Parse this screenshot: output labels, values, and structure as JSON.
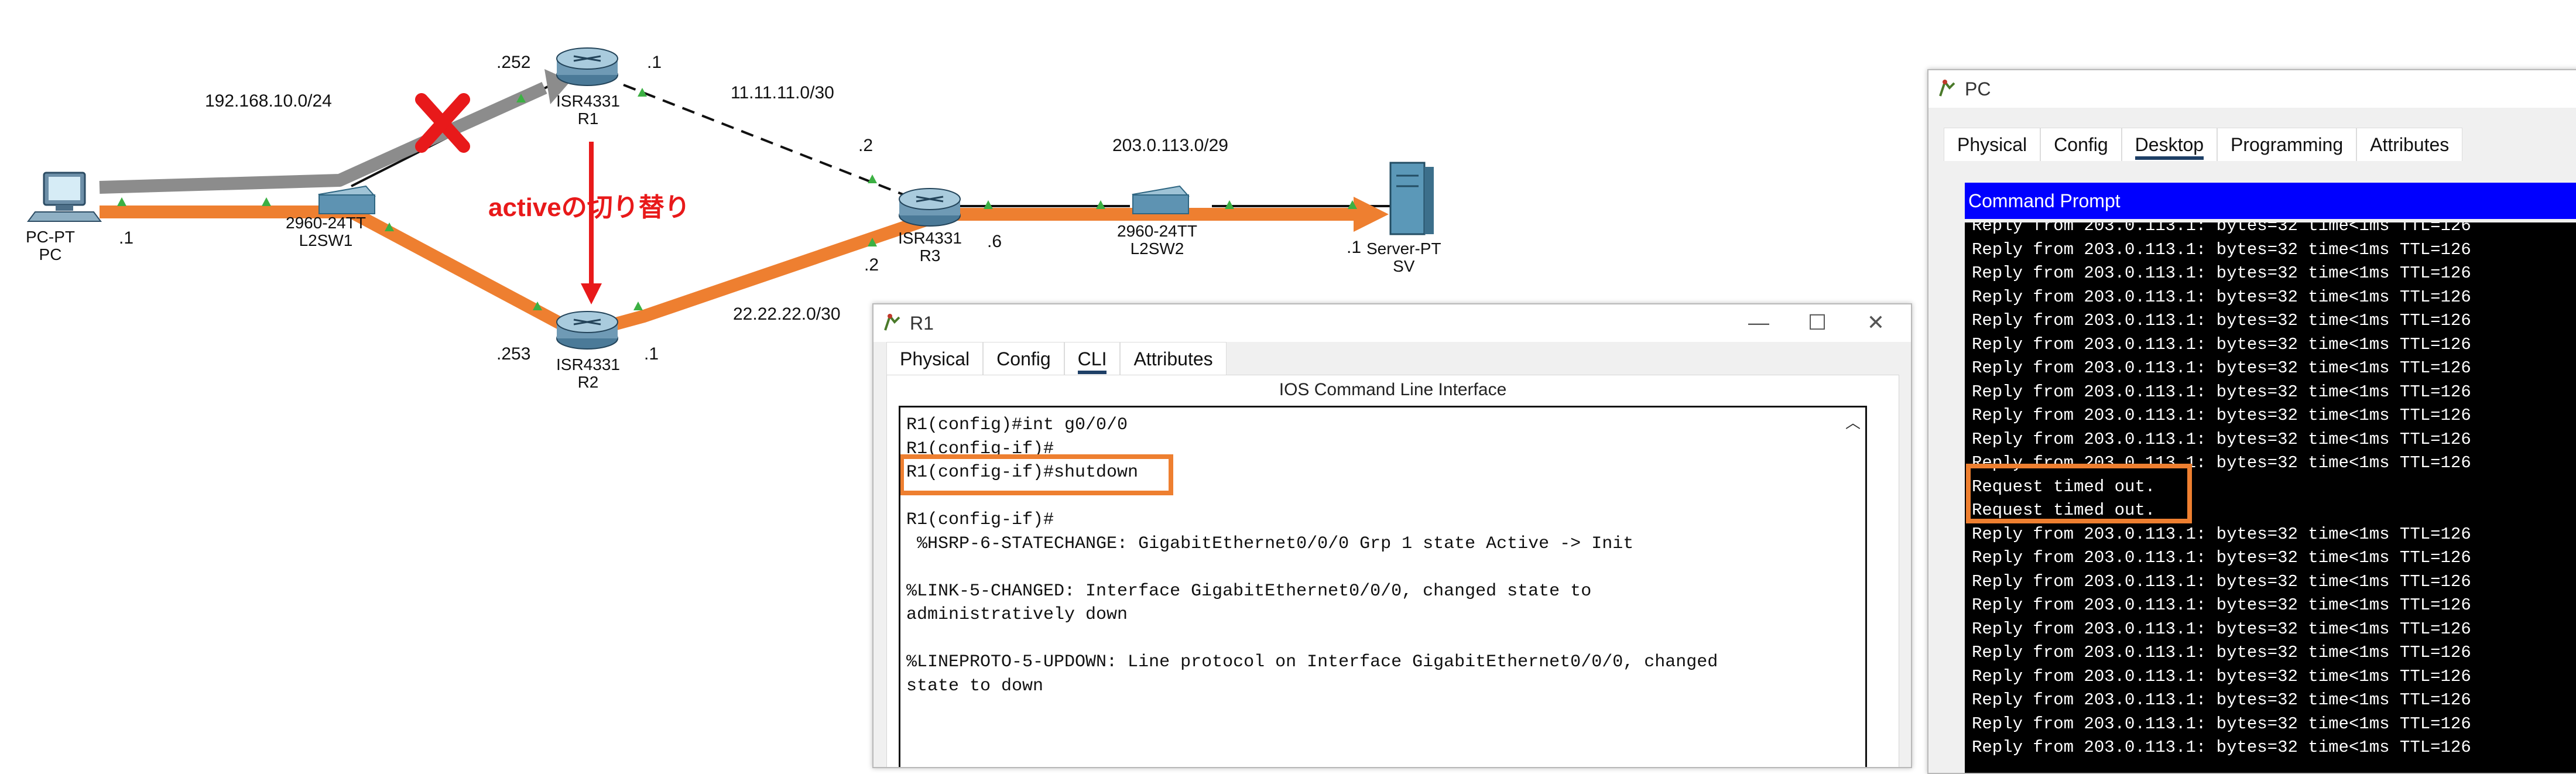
{
  "topology": {
    "subnets": {
      "lan": "192.168.10.0/24",
      "r1_r3": "11.11.11.0/30",
      "r2_r3": "22.22.22.0/30",
      "wan": "203.0.113.0/29"
    },
    "iface_labels": {
      "pc": ".1",
      "r1_left": ".252",
      "r1_right": ".1",
      "r2_left": ".253",
      "r2_right": ".1",
      "r3_top": ".2",
      "r3_bottom": ".2",
      "r3_right": ".6",
      "sv": ".1"
    },
    "devices": {
      "pc": {
        "model": "PC-PT",
        "name": "PC"
      },
      "l2sw1": {
        "model": "2960-24TT",
        "name": "L2SW1"
      },
      "r1": {
        "model": "ISR4331",
        "name": "R1"
      },
      "r2": {
        "model": "ISR4331",
        "name": "R2"
      },
      "r3": {
        "model": "ISR4331",
        "name": "R3"
      },
      "l2sw2": {
        "model": "2960-24TT",
        "name": "L2SW2"
      },
      "sv": {
        "model": "Server-PT",
        "name": "SV"
      }
    },
    "failover_label": "activeの切り替り",
    "colors": {
      "path": "#ee7f30",
      "failed_path": "#8c8c8c",
      "failure": "#e8191a",
      "link_up": "#3cb043"
    }
  },
  "r1_window": {
    "title": "R1",
    "tabs": [
      "Physical",
      "Config",
      "CLI",
      "Attributes"
    ],
    "active_tab": "CLI",
    "caption": "IOS Command Line Interface",
    "cli_lines": [
      "R1(config)#int g0/0/0",
      "R1(config-if)#",
      "R1(config-if)#shutdown",
      "",
      "R1(config-if)#",
      " %HSRP-6-STATECHANGE: GigabitEthernet0/0/0 Grp 1 state Active -> Init",
      "",
      "%LINK-5-CHANGED: Interface GigabitEthernet0/0/0, changed state to",
      "administratively down",
      "",
      "%LINEPROTO-5-UPDOWN: Line protocol on Interface GigabitEthernet0/0/0, changed",
      "state to down"
    ]
  },
  "pc_window": {
    "title": "PC",
    "tabs": [
      "Physical",
      "Config",
      "Desktop",
      "Programming",
      "Attributes"
    ],
    "active_tab": "Desktop",
    "cmd_title": "Command Prompt",
    "cmd_lines": [
      "Reply from 203.0.113.1: bytes=32 time<1ms TTL=126",
      "Reply from 203.0.113.1: bytes=32 time<1ms TTL=126",
      "Reply from 203.0.113.1: bytes=32 time<1ms TTL=126",
      "Reply from 203.0.113.1: bytes=32 time<1ms TTL=126",
      "Reply from 203.0.113.1: bytes=32 time<1ms TTL=126",
      "Reply from 203.0.113.1: bytes=32 time<1ms TTL=126",
      "Reply from 203.0.113.1: bytes=32 time<1ms TTL=126",
      "Reply from 203.0.113.1: bytes=32 time<1ms TTL=126",
      "Reply from 203.0.113.1: bytes=32 time<1ms TTL=126",
      "Reply from 203.0.113.1: bytes=32 time<1ms TTL=126",
      "Reply from 203.0.113.1: bytes=32 time<1ms TTL=126",
      "Request timed out.",
      "Request timed out.",
      "Reply from 203.0.113.1: bytes=32 time<1ms TTL=126",
      "Reply from 203.0.113.1: bytes=32 time<1ms TTL=126",
      "Reply from 203.0.113.1: bytes=32 time<1ms TTL=126",
      "Reply from 203.0.113.1: bytes=32 time<1ms TTL=126",
      "Reply from 203.0.113.1: bytes=32 time<1ms TTL=126",
      "Reply from 203.0.113.1: bytes=32 time<1ms TTL=126",
      "Reply from 203.0.113.1: bytes=32 time<1ms TTL=126",
      "Reply from 203.0.113.1: bytes=32 time<1ms TTL=126",
      "Reply from 203.0.113.1: bytes=32 time<1ms TTL=126",
      "Reply from 203.0.113.1: bytes=32 time<1ms TTL=126"
    ]
  }
}
